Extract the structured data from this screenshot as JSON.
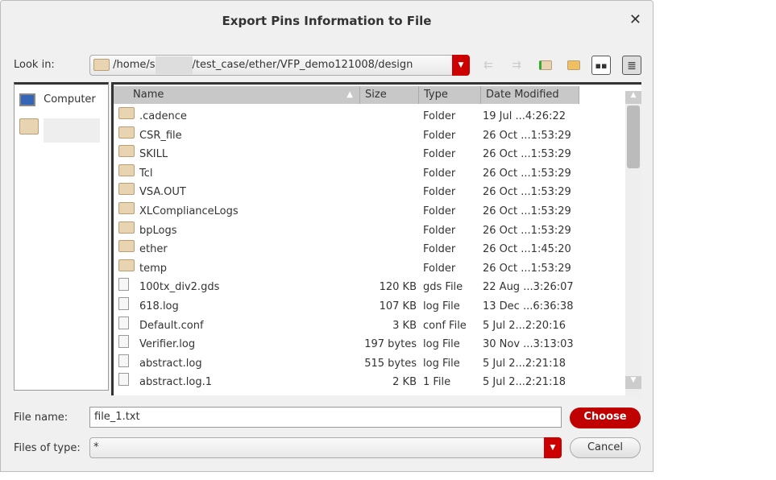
{
  "dialog": {
    "title": "Export Pins Information to File",
    "close_icon": "close-icon"
  },
  "look_in": {
    "label": "Look in:",
    "path_start": "/home/s",
    "path_end": "/test_case/ether/VFP_demo121008/design"
  },
  "toolbar": [
    "back-icon",
    "forward-icon",
    "parent-folder-icon",
    "new-folder-icon",
    "icon-view-icon",
    "detail-view-icon"
  ],
  "sidebar": {
    "items": [
      {
        "label": "Computer",
        "icon": "computer-icon"
      },
      {
        "label": "",
        "icon": "folder-icon"
      }
    ]
  },
  "columns": [
    "Name",
    "Size",
    "Type",
    "Date Modified"
  ],
  "files": [
    {
      "name": ".cadence",
      "size": "",
      "type": "Folder",
      "date": "19 Jul ...4:26:22",
      "folder": true
    },
    {
      "name": "CSR_file",
      "size": "",
      "type": "Folder",
      "date": "26 Oct ...1:53:29",
      "folder": true
    },
    {
      "name": "SKILL",
      "size": "",
      "type": "Folder",
      "date": "26 Oct ...1:53:29",
      "folder": true
    },
    {
      "name": "Tcl",
      "size": "",
      "type": "Folder",
      "date": "26 Oct ...1:53:29",
      "folder": true
    },
    {
      "name": "VSA.OUT",
      "size": "",
      "type": "Folder",
      "date": "26 Oct ...1:53:29",
      "folder": true
    },
    {
      "name": "XLComplianceLogs",
      "size": "",
      "type": "Folder",
      "date": "26 Oct ...1:53:29",
      "folder": true
    },
    {
      "name": "bpLogs",
      "size": "",
      "type": "Folder",
      "date": "26 Oct ...1:53:29",
      "folder": true
    },
    {
      "name": "ether",
      "size": "",
      "type": "Folder",
      "date": "26 Oct ...1:45:20",
      "folder": true
    },
    {
      "name": "temp",
      "size": "",
      "type": "Folder",
      "date": "26 Oct ...1:53:29",
      "folder": true
    },
    {
      "name": "100tx_div2.gds",
      "size": "120 KB",
      "type": "gds File",
      "date": "22 Aug ...3:26:07",
      "folder": false
    },
    {
      "name": "618.log",
      "size": "107 KB",
      "type": "log File",
      "date": "13 Dec ...6:36:38",
      "folder": false
    },
    {
      "name": "Default.conf",
      "size": "3 KB",
      "type": "conf File",
      "date": "5 Jul 2...2:20:16",
      "folder": false
    },
    {
      "name": "Verifier.log",
      "size": "197 bytes",
      "type": "log File",
      "date": "30 Nov ...3:13:03",
      "folder": false
    },
    {
      "name": "abstract.log",
      "size": "515 bytes",
      "type": "log File",
      "date": "5 Jul 2...2:21:18",
      "folder": false
    },
    {
      "name": "abstract.log.1",
      "size": "2 KB",
      "type": "1 File",
      "date": "5 Jul 2...2:21:18",
      "folder": false
    }
  ],
  "file_name": {
    "label": "File name:",
    "value": "file_1.txt"
  },
  "file_type": {
    "label": "Files of type:",
    "value": "*"
  },
  "buttons": {
    "choose": "Choose",
    "cancel": "Cancel"
  },
  "colors": {
    "accent": "#c00000"
  }
}
